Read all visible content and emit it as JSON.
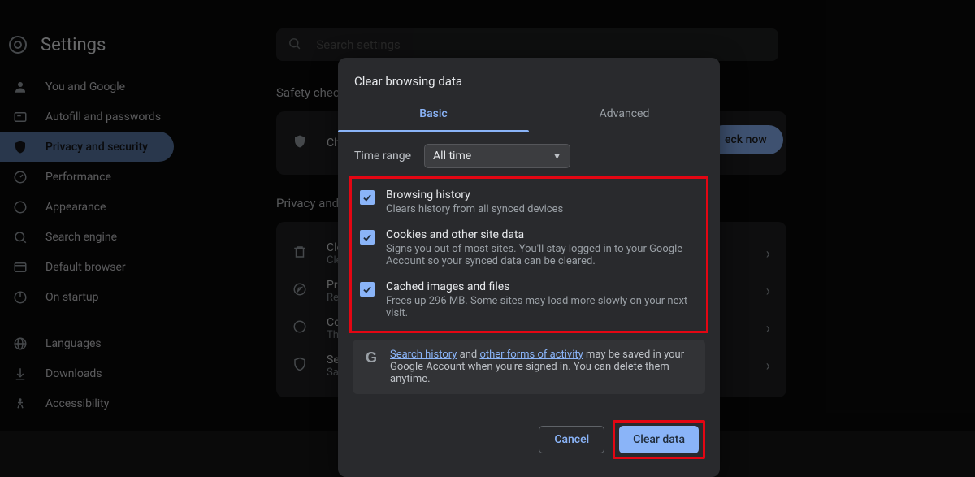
{
  "app": {
    "title": "Settings",
    "search_placeholder": "Search settings"
  },
  "sidebar": {
    "items": [
      {
        "label": "You and Google"
      },
      {
        "label": "Autofill and passwords"
      },
      {
        "label": "Privacy and security"
      },
      {
        "label": "Performance"
      },
      {
        "label": "Appearance"
      },
      {
        "label": "Search engine"
      },
      {
        "label": "Default browser"
      },
      {
        "label": "On startup"
      },
      {
        "label": "Languages"
      },
      {
        "label": "Downloads"
      },
      {
        "label": "Accessibility"
      }
    ]
  },
  "main": {
    "safety_title": "Safety check",
    "safety_row": "Chro",
    "check_now": "eck now",
    "privsec_title": "Privacy and",
    "rows": [
      {
        "title": "Clea",
        "desc": "Clea"
      },
      {
        "title": "Priv",
        "desc": "Rev"
      },
      {
        "title": "Coo",
        "desc": "Thir"
      },
      {
        "title": "Sec",
        "desc": "Safe"
      }
    ]
  },
  "dialog": {
    "title": "Clear browsing data",
    "tabs": {
      "basic": "Basic",
      "advanced": "Advanced"
    },
    "time_range_label": "Time range",
    "time_range_value": "All time",
    "options": [
      {
        "title": "Browsing history",
        "desc": "Clears history from all synced devices"
      },
      {
        "title": "Cookies and other site data",
        "desc": "Signs you out of most sites. You'll stay logged in to your Google Account so your synced data can be cleared."
      },
      {
        "title": "Cached images and files",
        "desc": "Frees up 296 MB. Some sites may load more slowly on your next visit."
      }
    ],
    "info": {
      "link1": "Search history",
      "mid1": " and ",
      "link2": "other forms of activity",
      "rest": " may be saved in your Google Account when you're signed in. You can delete them anytime."
    },
    "cancel": "Cancel",
    "clear": "Clear data"
  }
}
